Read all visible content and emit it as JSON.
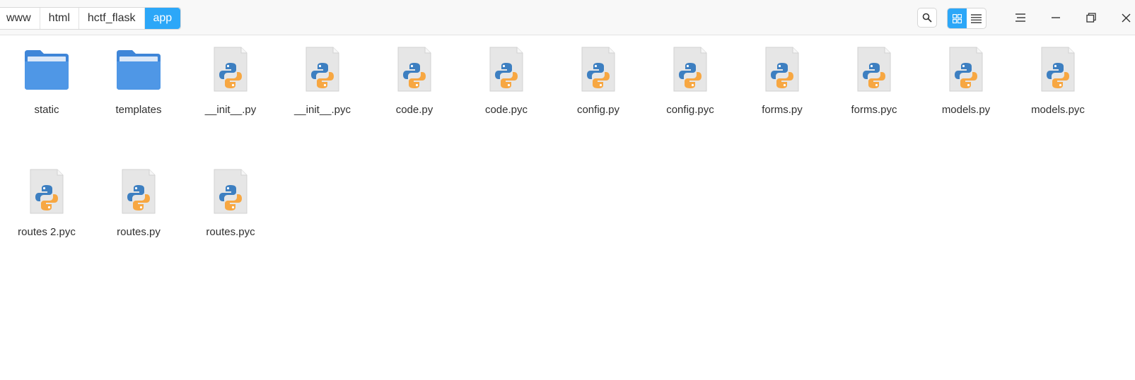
{
  "breadcrumb": [
    "www",
    "html",
    "hctf_flask",
    "app"
  ],
  "toolbar": {
    "search_icon": "search-icon",
    "icon_view_icon": "grid-view-icon",
    "list_view_icon": "list-view-icon",
    "menu_icon": "menu-icon",
    "minimize_icon": "minimize-icon",
    "restore_icon": "restore-icon",
    "close_icon": "close-icon"
  },
  "colors": {
    "accent": "#2ca7f8",
    "folder": "#4f97e6",
    "folder_light": "#7ab2ef",
    "py_blue": "#3d7fc1",
    "py_yellow": "#f7a742"
  },
  "files": [
    {
      "name": "static",
      "kind": "folder"
    },
    {
      "name": "templates",
      "kind": "folder"
    },
    {
      "name": "__init__.py",
      "kind": "python"
    },
    {
      "name": "__init__.pyc",
      "kind": "python"
    },
    {
      "name": "code.py",
      "kind": "python"
    },
    {
      "name": "code.pyc",
      "kind": "python"
    },
    {
      "name": "config.py",
      "kind": "python"
    },
    {
      "name": "config.pyc",
      "kind": "python"
    },
    {
      "name": "forms.py",
      "kind": "python"
    },
    {
      "name": "forms.pyc",
      "kind": "python"
    },
    {
      "name": "models.py",
      "kind": "python"
    },
    {
      "name": "models.pyc",
      "kind": "python"
    },
    {
      "name": "routes 2.pyc",
      "kind": "python"
    },
    {
      "name": "routes.py",
      "kind": "python"
    },
    {
      "name": "routes.pyc",
      "kind": "python"
    }
  ]
}
